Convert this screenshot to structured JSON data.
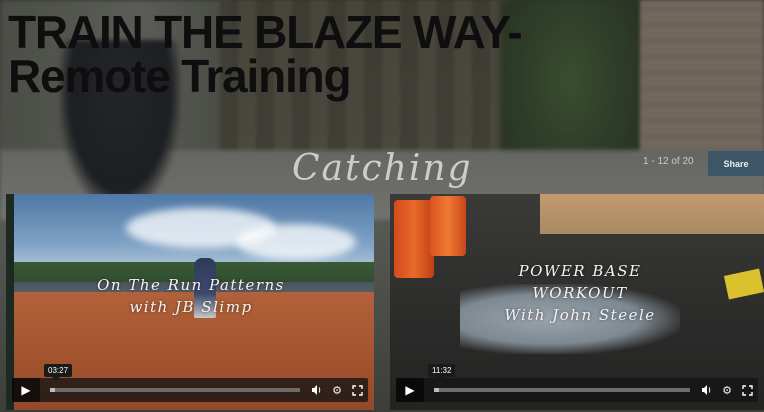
{
  "header": {
    "title_line1": "TRAIN THE BLAZE WAY-",
    "title_line2": "Remote Training",
    "background_caption": "Catching"
  },
  "pager": {
    "count_text": "1 - 12 of 20"
  },
  "actions": {
    "share_label": "Share"
  },
  "videos": [
    {
      "overlay_line1": "On The Run Patterns",
      "overlay_line2": "with JB Slimp",
      "duration": "03:27",
      "progress": 0.02
    },
    {
      "overlay_line1": "POWER BASE",
      "overlay_line2": "WORKOUT",
      "overlay_line3": "With John Steele",
      "duration": "11:32",
      "progress": 0.02
    }
  ],
  "icons": {
    "play": "play-icon",
    "volume": "volume-icon",
    "settings": "gear-icon",
    "fullscreen": "fullscreen-icon"
  },
  "colors": {
    "share_button_bg": "#3c5668",
    "title_text": "#0e0e0e"
  }
}
